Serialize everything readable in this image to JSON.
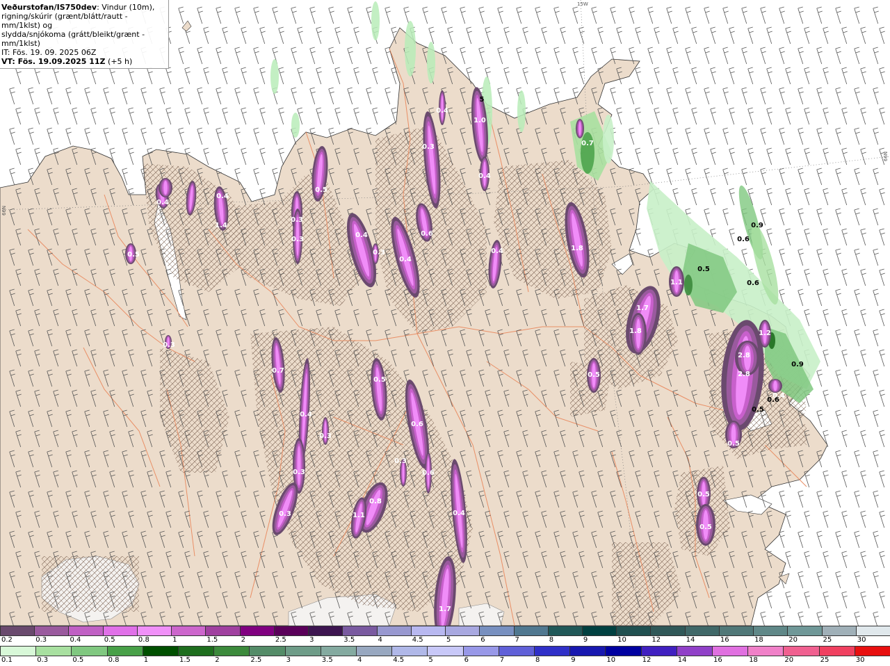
{
  "info": {
    "source": "Veðurstofan/IS750dev",
    "desc_1": ": Vindur (10m),",
    "desc_2": "rigning/skúrir (grænt/blátt/rautt - mm/1klst) og",
    "desc_3": "slydda/snjókoma (grátt/bleikt/grænt - mm/1klst)",
    "it_line": "IT: Fös. 19. 09. 2025 06Z",
    "vt_bold": "VT: Fös. 19.09.2025 11Z",
    "vt_lead": " (+5 h)"
  },
  "map": {
    "grid_labels": {
      "top": "15W",
      "right": "66N",
      "left": "66N"
    },
    "colors": {
      "land": "#ecdccb",
      "sea": "#ffffff",
      "roads": "#e98f66",
      "hatch": "#8a7060"
    },
    "sleet_cells": [
      {
        "label": "0.4"
      },
      {
        "label": "1.4"
      },
      {
        "label": "0.4"
      },
      {
        "label": "0.8"
      },
      {
        "label": "0.5"
      },
      {
        "label": "0.3"
      },
      {
        "label": "0.3"
      },
      {
        "label": "0.4"
      },
      {
        "label": "0.3"
      },
      {
        "label": "0.6"
      },
      {
        "label": "0.7"
      },
      {
        "label": "0.5"
      },
      {
        "label": "0.4"
      },
      {
        "label": "0.4"
      },
      {
        "label": "1.0"
      },
      {
        "label": "0.4"
      },
      {
        "label": "0.3"
      },
      {
        "label": "1.8"
      },
      {
        "label": "0.4"
      },
      {
        "label": "1.7"
      },
      {
        "label": "1.8"
      },
      {
        "label": "1.1"
      },
      {
        "label": "0.5"
      },
      {
        "label": "0.7"
      },
      {
        "label": "0.3"
      },
      {
        "label": "0.4"
      },
      {
        "label": "0.5"
      },
      {
        "label": "0.6"
      },
      {
        "label": "0.3"
      },
      {
        "label": "0.6"
      },
      {
        "label": "0.3"
      },
      {
        "label": "0.3"
      },
      {
        "label": "0.8"
      },
      {
        "label": "1.1"
      },
      {
        "label": "0.4"
      },
      {
        "label": "2.8"
      },
      {
        "label": "2.8"
      },
      {
        "label": "1.2"
      },
      {
        "label": "0.4"
      },
      {
        "label": "0.5"
      },
      {
        "label": "0.5"
      },
      {
        "label": "0.5"
      },
      {
        "label": "1.7"
      },
      {
        "label": "0.3"
      }
    ],
    "rain_labels": [
      {
        "label": "0.9"
      },
      {
        "label": "0.6"
      },
      {
        "label": "0.5"
      },
      {
        "label": "0.6"
      },
      {
        "label": "0.9"
      },
      {
        "label": "0.6"
      },
      {
        "label": "0.5"
      },
      {
        "label": "5"
      }
    ]
  },
  "legend_snow": {
    "labels": [
      "0.2",
      "0.3",
      "0.4",
      "0.5",
      "0.8",
      "1",
      "1.5",
      "2",
      "2.5",
      "3",
      "3.5",
      "4",
      "4.5",
      "5",
      "6",
      "7",
      "8",
      "9",
      "10",
      "12",
      "14",
      "16",
      "18",
      "20",
      "25",
      "30"
    ],
    "colors": [
      "#6a4a6e",
      "#9a5a9e",
      "#c060c4",
      "#e070e8",
      "#f090f8",
      "#cc66cc",
      "#a040a0",
      "#800080",
      "#5a005a",
      "#3d1550",
      "#7a5aa0",
      "#9898d0",
      "#b8b8f0",
      "#a8a8e0",
      "#7890c0",
      "#507890",
      "#205858",
      "#004040",
      "#205050",
      "#305858",
      "#406868",
      "#507878",
      "#608888",
      "#709898",
      "#a0b0b8",
      "#e0e8ec"
    ]
  },
  "legend_rain": {
    "labels": [
      "0.1",
      "0.3",
      "0.5",
      "0.8",
      "1",
      "1.5",
      "2",
      "2.5",
      "3",
      "3.5",
      "4",
      "4.5",
      "5",
      "6",
      "7",
      "8",
      "9",
      "10",
      "12",
      "14",
      "16",
      "18",
      "20",
      "25",
      "30"
    ],
    "colors": [
      "#d8f8d8",
      "#a8e0a0",
      "#80c880",
      "#48a048",
      "#005000",
      "#1e6e1e",
      "#3c8a3c",
      "#548c68",
      "#6e9c88",
      "#84aaa0",
      "#98a8c0",
      "#b0b8e8",
      "#c8c8f8",
      "#9898e8",
      "#6060d8",
      "#3030c8",
      "#1818b0",
      "#0000a0",
      "#4020c0",
      "#9040c8",
      "#e070e0",
      "#f080c8",
      "#f06090",
      "#f04060",
      "#e81010"
    ]
  }
}
